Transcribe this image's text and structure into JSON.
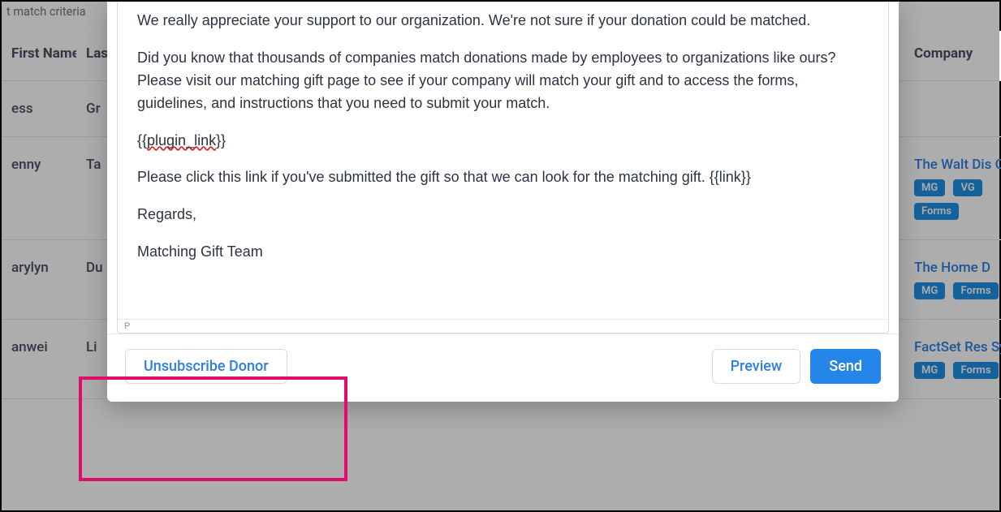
{
  "filter_label": "t match criteria",
  "table": {
    "headers": {
      "first_name": "First Name",
      "last_name": "Last Name",
      "company": "Company"
    },
    "rows": [
      {
        "first_name": "ess",
        "last_name": "Gr",
        "company": "",
        "badges": []
      },
      {
        "first_name": "enny",
        "last_name": "Ta",
        "company": "The Walt Dis Corporation",
        "badges": [
          "MG",
          "VG",
          "Forms"
        ]
      },
      {
        "first_name": "arylyn",
        "last_name": "Du",
        "company": "The Home D",
        "badges": [
          "MG",
          "Forms"
        ]
      },
      {
        "first_name": "anwei",
        "last_name": "Li",
        "company": "FactSet Res Systems",
        "badges": [
          "MG",
          "Forms"
        ]
      }
    ]
  },
  "email_body": {
    "p1": "We really appreciate your support to our organization. We're not sure if your donation could be matched.",
    "p2": "Did you know that thousands of companies match donations made by employees to organizations like ours? Please visit our matching gift page to see if your company will match your gift and to access the forms, guidelines, and instructions that you need to submit your match.",
    "p3_open": "{{",
    "p3_token": "plugin_link",
    "p3_close": "}}",
    "p4": "Please click this link if you've submitted the gift so that we can look for the matching gift. {{link}}",
    "p5": "Regards,",
    "p6": "Matching Gift Team"
  },
  "status_path": "P",
  "buttons": {
    "unsubscribe": "Unsubscribe Donor",
    "preview": "Preview",
    "send": "Send"
  }
}
